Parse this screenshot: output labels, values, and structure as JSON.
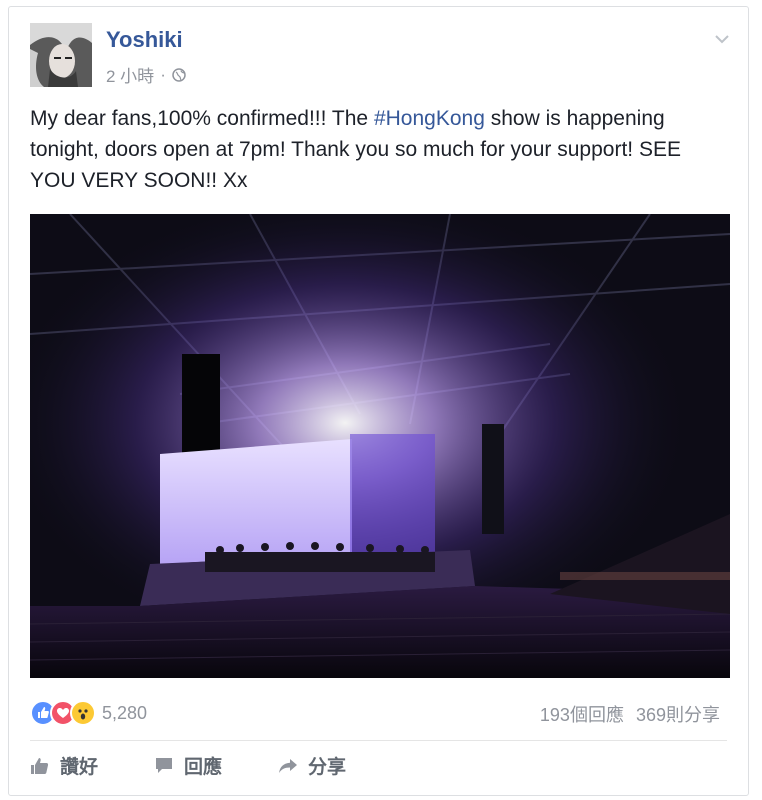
{
  "post": {
    "author": "Yoshiki",
    "timestamp": "2 小時",
    "dot": "·",
    "text_before_tag": "My dear fans,100% confirmed!!! The ",
    "hashtag": "#HongKong",
    "text_after_tag": " show is happening tonight, doors open at 7pm! Thank you so much for your support! SEE YOU VERY SOON!! Xx"
  },
  "reactions": {
    "icons": [
      "like-icon",
      "love-icon",
      "wow-icon"
    ],
    "count": "5,280"
  },
  "stats": {
    "comments": "193個回應",
    "shares": "369則分享"
  },
  "actions": {
    "like": "讚好",
    "comment": "回應",
    "share": "分享"
  },
  "colors": {
    "link": "#365899",
    "like_blue": "#5890ff",
    "love_red": "#f25268",
    "wow_yellow": "#fcc934",
    "muted": "#90949c"
  }
}
